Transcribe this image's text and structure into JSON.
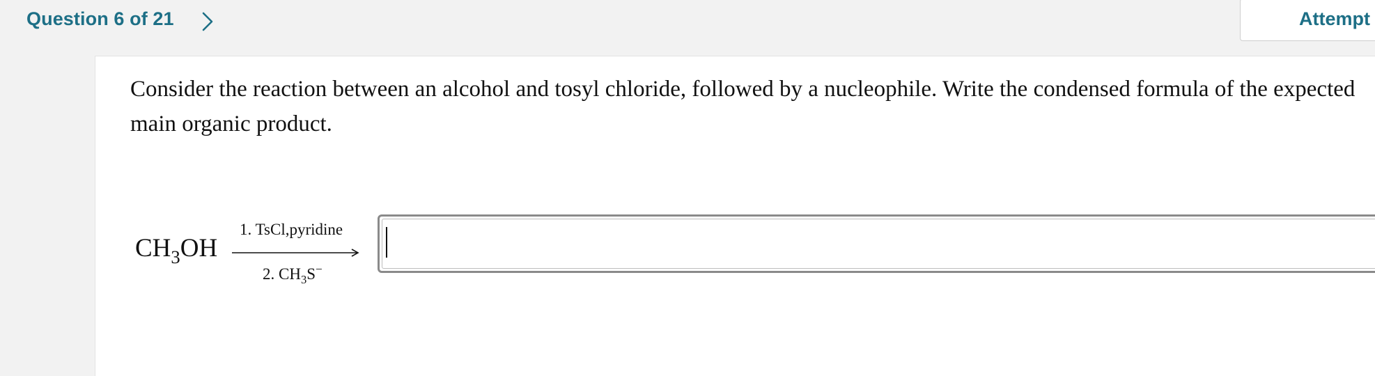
{
  "header": {
    "question_counter": "Question 6 of 21",
    "attempt_label": "Attempt"
  },
  "question": {
    "prompt": "Consider the reaction between an alcohol and tosyl chloride, followed by a nucleophile. Write the condensed formula of the expected main organic product.",
    "reaction": {
      "reactant_prefix": "CH",
      "reactant_subscript": "3",
      "reactant_suffix": "OH",
      "condition_1": "1. TsCl,pyridine",
      "condition_2_prefix": "2. CH",
      "condition_2_subscript": "3",
      "condition_2_suffix": "S",
      "condition_2_superscript": "−"
    },
    "answer": {
      "value": "",
      "placeholder": ""
    }
  },
  "colors": {
    "accent": "#1d6f86",
    "background": "#f2f2f2",
    "card": "#ffffff",
    "input_border": "#8a8a8a"
  },
  "icons": {
    "next": "chevron-right-icon"
  }
}
